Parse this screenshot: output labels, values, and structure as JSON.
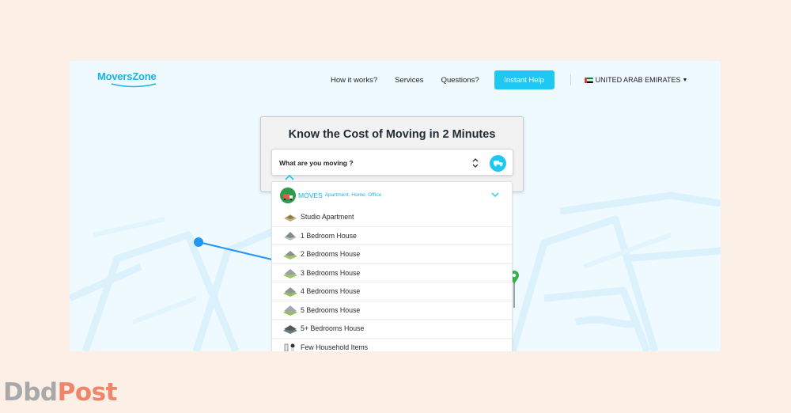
{
  "app": {
    "logo_text": "MoversZone"
  },
  "nav": {
    "links": [
      "How it works?",
      "Services",
      "Questions?"
    ],
    "instant_help": "Instant Help",
    "country": "UNITED ARAB EMIRATES"
  },
  "card": {
    "title": "Know the Cost of Moving in 2 Minutes",
    "select_placeholder": "What are you moving ?"
  },
  "dropdown": {
    "category": "MOVES",
    "category_sub": "Apartment, Home, Office",
    "items": [
      "Studio Apartment",
      "1 Bedroom House",
      "2 Bedrooms House",
      "3 Bedrooms House",
      "4 Bedrooms House",
      "5 Bedrooms House",
      "5+ Bedrooms House",
      "Few Household Items"
    ]
  },
  "watermark": {
    "part1": "Dbd",
    "part2": "Post"
  },
  "colors": {
    "accent": "#1fc8f3",
    "route": "#2196f3",
    "pin": "#34b24a",
    "watermark": "#f0856b"
  },
  "icons": [
    "up-down-icon",
    "truck-icon",
    "chevron-up-icon",
    "chevron-down-icon",
    "house-icon",
    "map-pin-icon",
    "route-start-icon",
    "caret-down-icon"
  ]
}
